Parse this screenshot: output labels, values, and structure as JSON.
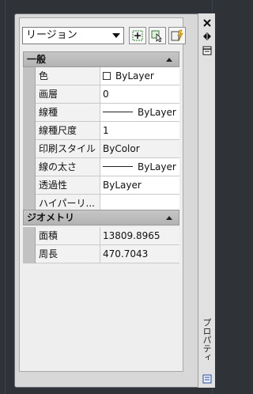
{
  "toolbar": {
    "object_select": "リージョン",
    "icons": [
      "toggle-pickadd-icon",
      "select-objects-icon",
      "quick-select-icon"
    ]
  },
  "sections": [
    {
      "title": "一般",
      "rows": [
        {
          "name": "色",
          "value": "ByLayer",
          "kind": "color"
        },
        {
          "name": "画層",
          "value": "0",
          "kind": "text"
        },
        {
          "name": "線種",
          "value": "ByLayer",
          "kind": "linetype"
        },
        {
          "name": "線種尺度",
          "value": "1",
          "kind": "text"
        },
        {
          "name": "印刷スタイル",
          "value": "ByColor",
          "kind": "plain"
        },
        {
          "name": "線の太さ",
          "value": "ByLayer",
          "kind": "linetype"
        },
        {
          "name": "透過性",
          "value": "ByLayer",
          "kind": "text"
        },
        {
          "name": "ハイパーリ...",
          "value": "",
          "kind": "text"
        }
      ]
    },
    {
      "title": "ジオメトリ",
      "rows": [
        {
          "name": "面積",
          "value": "13809.8965",
          "kind": "plain"
        },
        {
          "name": "周長",
          "value": "470.7043",
          "kind": "plain"
        }
      ]
    }
  ],
  "palette": {
    "title": "プロパティ",
    "icons": [
      "close-icon",
      "auto-hide-icon",
      "properties-menu-icon",
      "palette-title-icon"
    ]
  }
}
